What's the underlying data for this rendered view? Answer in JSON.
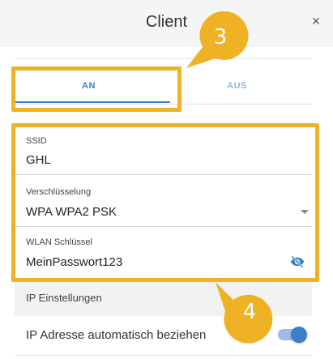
{
  "header": {
    "title": "Client",
    "close_symbol": "×"
  },
  "tabs": [
    {
      "label": "AN",
      "active": true
    },
    {
      "label": "AUS",
      "active": false
    }
  ],
  "fields": {
    "ssid": {
      "label": "SSID",
      "value": "GHL"
    },
    "encryption": {
      "label": "Verschlüsselung",
      "value": "WPA WPA2 PSK"
    },
    "wlan_key": {
      "label": "WLAN Schlüssel",
      "value": "MeinPasswort123"
    }
  },
  "ip_section": {
    "title": "IP Einstellungen",
    "auto_label": "IP Adresse automatisch beziehen",
    "auto_enabled": true
  },
  "callouts": [
    {
      "number": "3"
    },
    {
      "number": "4"
    }
  ],
  "colors": {
    "accent": "#3d7fc7",
    "highlight": "#efb225",
    "tab_inactive": "#8fb7df"
  },
  "icons": {
    "close": "close-icon",
    "dropdown": "chevron-down-icon",
    "visibility": "eye-off-icon"
  }
}
